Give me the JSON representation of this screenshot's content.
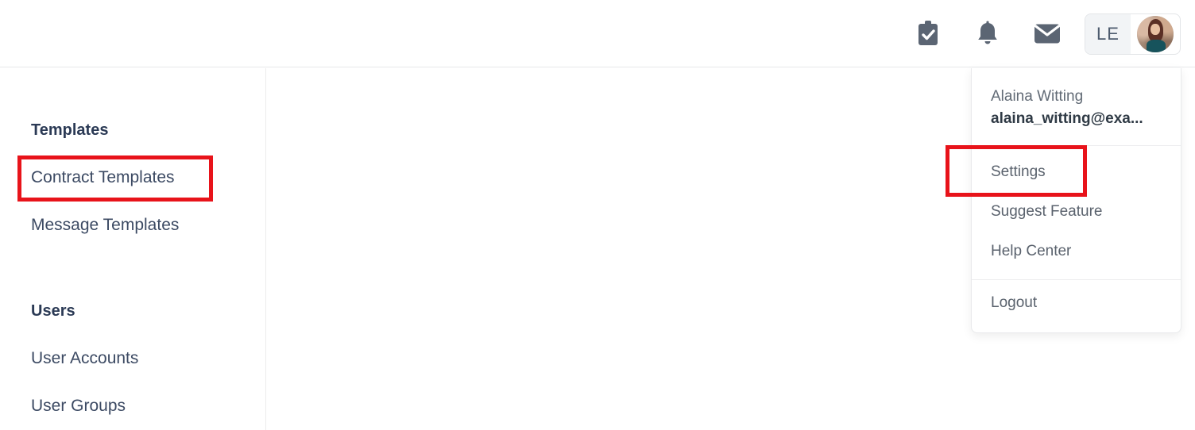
{
  "topbar": {
    "icons": [
      {
        "name": "clipboard-check-icon",
        "label": "Tasks"
      },
      {
        "name": "bell-icon",
        "label": "Notifications"
      },
      {
        "name": "envelope-icon",
        "label": "Messages"
      }
    ],
    "profile": {
      "initials": "LE",
      "avatar_alt": "User profile photo"
    }
  },
  "sidebar": {
    "sections": [
      {
        "title": "Templates",
        "items": [
          {
            "label": "Contract Templates",
            "highlighted": true
          },
          {
            "label": "Message Templates",
            "highlighted": false
          }
        ]
      },
      {
        "title": "Users",
        "items": [
          {
            "label": "User Accounts",
            "highlighted": false
          },
          {
            "label": "User Groups",
            "highlighted": false
          }
        ]
      }
    ]
  },
  "dropdown": {
    "user_name": "Alaina Witting",
    "user_email": "alaina_witting@exa...",
    "items": [
      {
        "label": "Settings",
        "highlighted": true
      },
      {
        "label": "Suggest Feature",
        "highlighted": false
      },
      {
        "label": "Help Center",
        "highlighted": false
      }
    ],
    "logout_label": "Logout"
  },
  "annotations": {
    "accent_color": "#e8131a",
    "boxes": [
      {
        "target": "Contract Templates"
      },
      {
        "target": "Settings"
      }
    ]
  }
}
